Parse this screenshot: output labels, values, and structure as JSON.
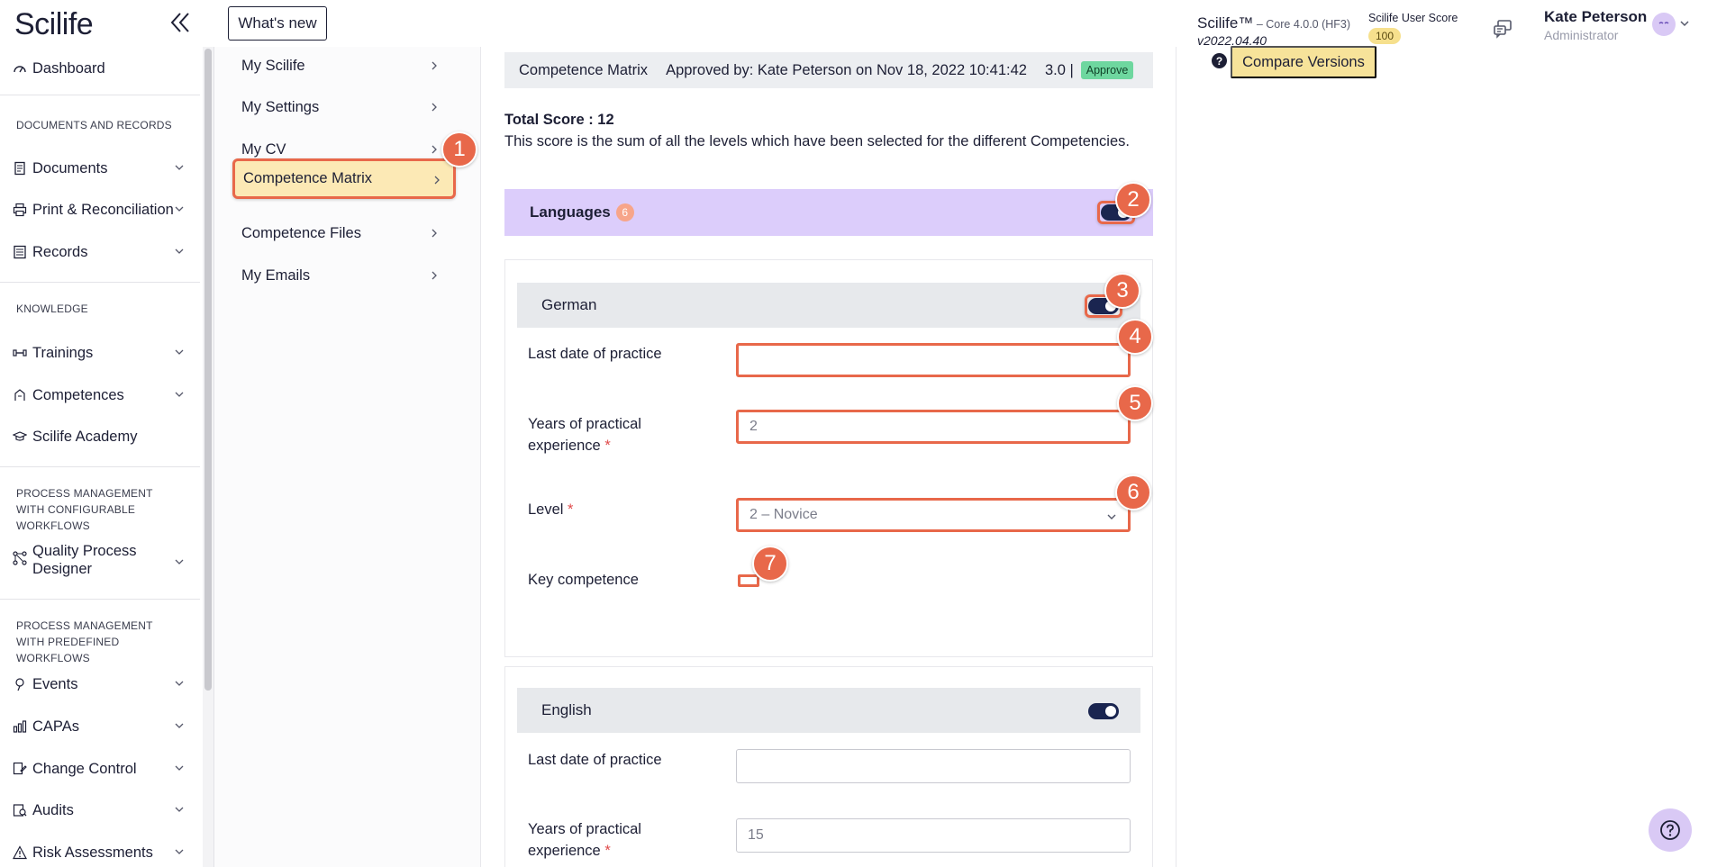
{
  "topbar": {
    "logo": "Scilife",
    "whats_new": "What's new",
    "product": "Scilife™",
    "core": " – Core 4.0.0 (HF3)",
    "version": "v2022.04.40",
    "score_label": "Scilife User Score",
    "score_value": "100",
    "user_name": "Kate Peterson",
    "user_role": "Administrator"
  },
  "sidebar": {
    "dashboard": "Dashboard",
    "section_docs": "DOCUMENTS AND RECORDS",
    "documents": "Documents",
    "print": "Print & Reconciliation",
    "records": "Records",
    "section_knowledge": "KNOWLEDGE",
    "trainings": "Trainings",
    "competences": "Competences",
    "academy": "Scilife Academy",
    "section_process_config": "PROCESS MANAGEMENT WITH CONFIGURABLE WORKFLOWS",
    "qpd": "Quality Process Designer",
    "section_process_predef": "PROCESS MANAGEMENT WITH PREDEFINED WORKFLOWS",
    "events": "Events",
    "capas": "CAPAs",
    "change_control": "Change Control",
    "audits": "Audits",
    "risk": "Risk Assessments"
  },
  "subnav": {
    "my_scilife": "My Scilife",
    "my_settings": "My Settings",
    "my_cv": "My CV",
    "competence_matrix": "Competence Matrix",
    "competence_files": "Competence Files",
    "my_emails": "My Emails"
  },
  "main": {
    "header_title": "Competence Matrix",
    "approved_by": "Approved by: Kate Peterson on Nov 18, 2022 10:41:42",
    "version_no": "3.0 |",
    "approve_badge": "Approve",
    "total_score": "Total Score : 12",
    "score_desc": "This score is the sum of all the levels which have been selected for the different Competencies.",
    "languages_label": "Languages",
    "languages_count": "6"
  },
  "cards": {
    "german": {
      "name": "German",
      "last_date_label": "Last date of practice",
      "last_date_value": "",
      "years_label_1": "Years of practical",
      "years_label_2": "experience",
      "years_value": "2",
      "level_label": "Level",
      "level_value": "2 – Novice",
      "key_label": "Key competence"
    },
    "english": {
      "name": "English",
      "last_date_label": "Last date of practice",
      "last_date_value": "",
      "years_label_1": "Years of practical",
      "years_label_2": "experience",
      "years_value": "15"
    }
  },
  "markers": [
    "1",
    "2",
    "3",
    "4",
    "5",
    "6",
    "7"
  ],
  "right": {
    "compare_versions": "Compare Versions",
    "help_q": "?"
  },
  "colors": {
    "accent_marker": "#e8684a",
    "languages_bar": "#dccdfb",
    "toggle_on": "#1a2550",
    "compare_button": "#f7e39a",
    "approve_badge": "#6ed79f"
  }
}
